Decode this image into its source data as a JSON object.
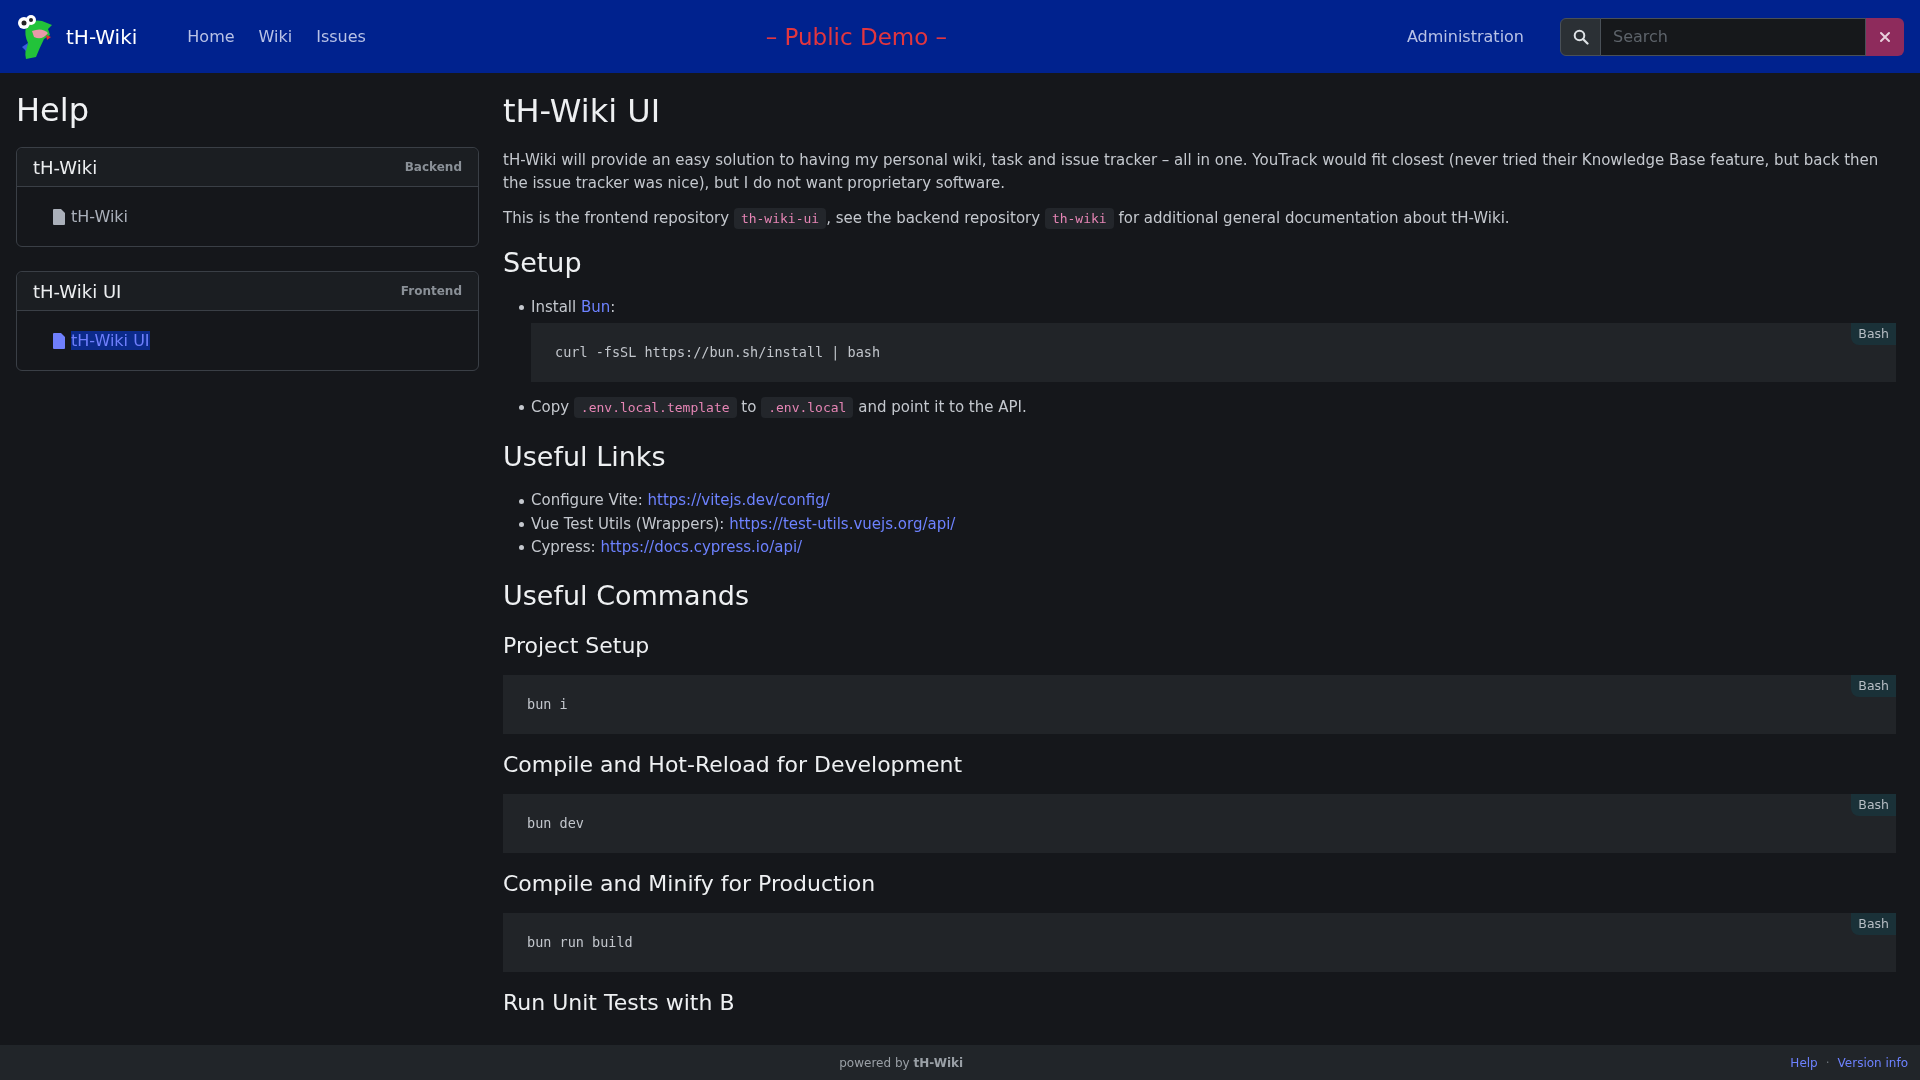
{
  "header": {
    "brand": "tH-Wiki",
    "nav": [
      {
        "label": "Home",
        "selected": false
      },
      {
        "label": "Wiki",
        "selected": false
      },
      {
        "label": "Issues",
        "selected": false
      }
    ],
    "banner": "– Public Demo –",
    "admin": "Administration",
    "search": {
      "placeholder": "Search"
    }
  },
  "sidebar": {
    "title": "Help",
    "groups": [
      {
        "title": "tH-Wiki",
        "tag": "Backend",
        "items": [
          {
            "label": "tH-Wiki",
            "selected": false
          }
        ]
      },
      {
        "title": "tH-Wiki UI",
        "tag": "Frontend",
        "items": [
          {
            "label": "tH-Wiki UI",
            "selected": true
          }
        ]
      }
    ]
  },
  "article": {
    "title": "tH-Wiki UI",
    "blocks": [
      {
        "kind": "paragraph",
        "parts": [
          {
            "kind": "text",
            "text": "tH-Wiki will provide an easy solution to having my personal wiki, task and issue tracker – all in one. YouTrack would fit closest (never tried their Knowledge Base feature, but back then the issue tracker was nice), but I do not want proprietary software."
          }
        ]
      },
      {
        "kind": "paragraph",
        "parts": [
          {
            "kind": "text",
            "text": "This is the frontend repository "
          },
          {
            "kind": "code",
            "text": "th-wiki-ui"
          },
          {
            "kind": "text",
            "text": ", see the backend repository "
          },
          {
            "kind": "code",
            "text": "th-wiki"
          },
          {
            "kind": "text",
            "text": " for additional general documentation about tH-Wiki."
          }
        ]
      },
      {
        "kind": "h2",
        "text": "Setup"
      },
      {
        "kind": "list",
        "items": [
          {
            "parts": [
              {
                "kind": "text",
                "text": "Install "
              },
              {
                "kind": "link",
                "text": "Bun"
              },
              {
                "kind": "text",
                "text": ":"
              }
            ],
            "code": {
              "lang": "Bash",
              "text": "curl -fsSL https://bun.sh/install | bash"
            }
          },
          {
            "parts": [
              {
                "kind": "text",
                "text": "Copy "
              },
              {
                "kind": "code",
                "text": ".env.local.template"
              },
              {
                "kind": "text",
                "text": " to "
              },
              {
                "kind": "code",
                "text": ".env.local"
              },
              {
                "kind": "text",
                "text": " and point it to the API."
              }
            ]
          }
        ]
      },
      {
        "kind": "h2",
        "text": "Useful Links"
      },
      {
        "kind": "list",
        "items": [
          {
            "parts": [
              {
                "kind": "text",
                "text": "Configure Vite: "
              },
              {
                "kind": "link",
                "text": "https://vitejs.dev/config/"
              }
            ]
          },
          {
            "parts": [
              {
                "kind": "text",
                "text": "Vue Test Utils (Wrappers): "
              },
              {
                "kind": "link",
                "text": "https://test-utils.vuejs.org/api/"
              }
            ]
          },
          {
            "parts": [
              {
                "kind": "text",
                "text": "Cypress: "
              },
              {
                "kind": "link",
                "text": "https://docs.cypress.io/api/"
              }
            ]
          }
        ]
      },
      {
        "kind": "h2",
        "text": "Useful Commands"
      },
      {
        "kind": "h3",
        "text": "Project Setup"
      },
      {
        "kind": "code",
        "lang": "Bash",
        "text": "bun i"
      },
      {
        "kind": "h3",
        "text": "Compile and Hot-Reload for Development"
      },
      {
        "kind": "code",
        "lang": "Bash",
        "text": "bun dev"
      },
      {
        "kind": "h3",
        "text": "Compile and Minify for Production"
      },
      {
        "kind": "code",
        "lang": "Bash",
        "text": "bun run build"
      },
      {
        "kind": "h3",
        "text": "Run Unit Tests with B"
      }
    ]
  },
  "footer": {
    "powered": "powered by **tH-Wiki**",
    "links": [
      "Help",
      "Version info"
    ],
    "separator": "·"
  }
}
